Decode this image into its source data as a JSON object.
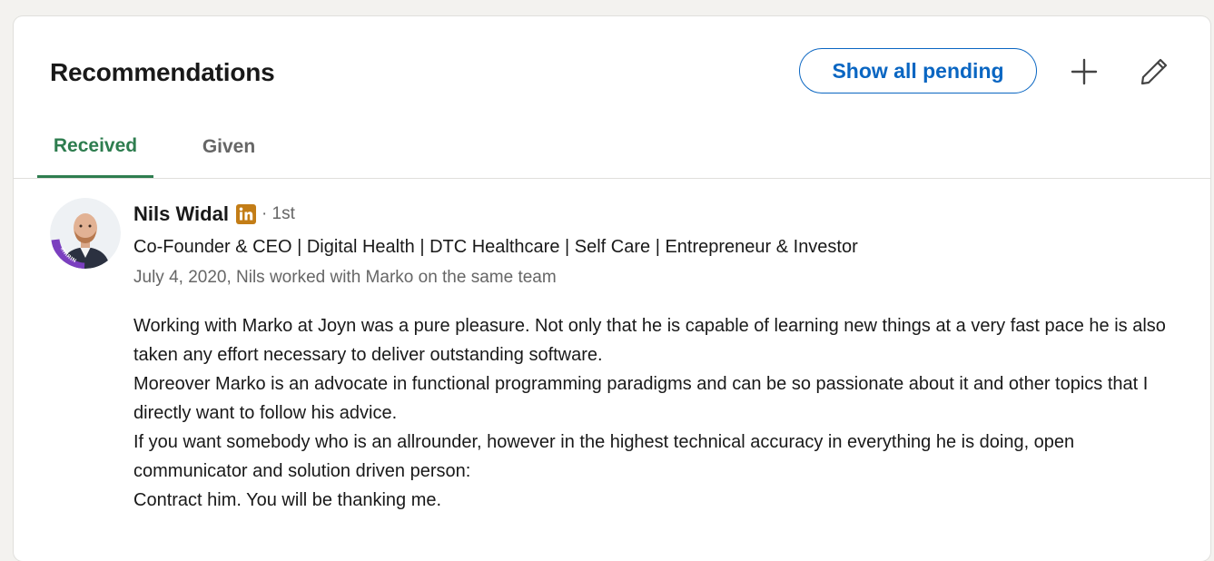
{
  "section": {
    "title": "Recommendations",
    "show_pending_label": "Show all pending",
    "add_icon": "plus-icon",
    "edit_icon": "pencil-icon"
  },
  "tabs": [
    {
      "label": "Received",
      "active": true
    },
    {
      "label": "Given",
      "active": false
    }
  ],
  "recommendation": {
    "name": "Nils Widal",
    "badge_icon": "linkedin-icon",
    "degree": "· 1st",
    "headline": "Co-Founder & CEO | Digital Health | DTC Healthcare | Self Care | Entrepreneur & Investor",
    "meta": "July 4, 2020, Nils worked with Marko on the same team",
    "avatar_badge_text": "#HIRING",
    "paragraphs": [
      "Working with Marko at Joyn was a pure pleasure. Not only that he is capable of learning new things at a very fast pace he is also taken any effort necessary to deliver outstanding software.",
      "Moreover Marko is an advocate in functional programming paradigms and can be so passionate about it and other topics that I directly want to follow his advice.",
      "If you want somebody who is an allrounder, however in the highest technical accuracy in everything he is doing, open communicator and solution driven person:",
      "Contract him. You will be thanking me."
    ]
  },
  "colors": {
    "accent_blue": "#0a66c2",
    "active_tab_green": "#2e7d4f",
    "hiring_ring": "#7b3fbf",
    "linkedin_badge": "#c37d16"
  }
}
